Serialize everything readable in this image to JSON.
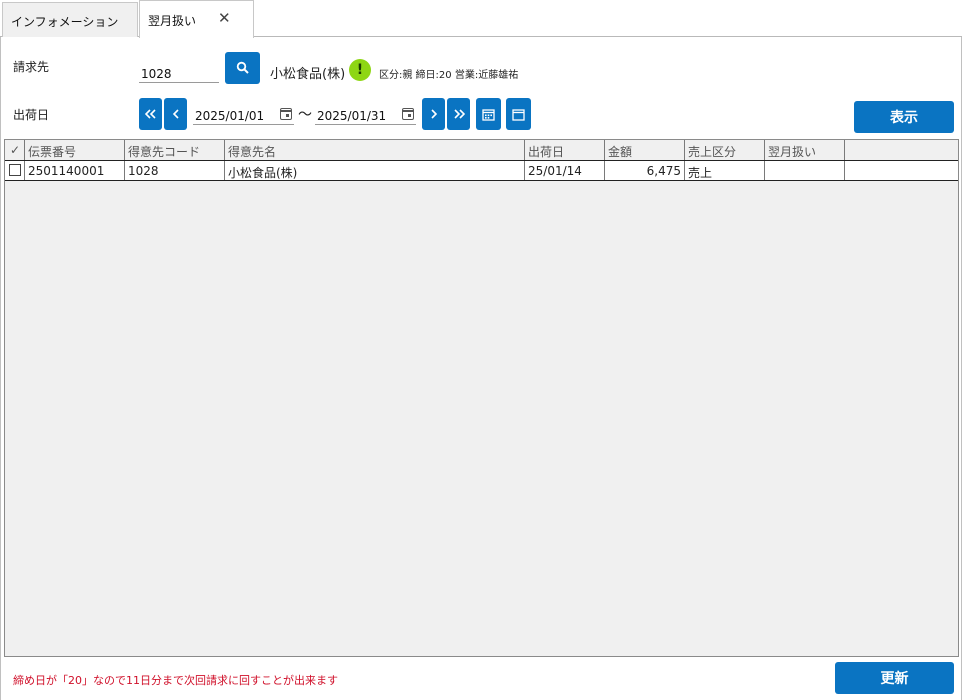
{
  "tabs": [
    {
      "label": "インフォメーション"
    },
    {
      "label": "翌月扱い"
    }
  ],
  "form": {
    "billing_label": "請求先",
    "billing_code": "1028",
    "customer_name": "小松食品(株)",
    "warning_glyph": "!",
    "customer_info": "区分:親 締日:20 営業:近藤雄祐",
    "ship_date_label": "出荷日",
    "date_from": "2025/01/01",
    "date_to": "2025/01/31",
    "range_separator": "～",
    "show_button": "表示"
  },
  "grid": {
    "columns": [
      "✓",
      "伝票番号",
      "得意先コード",
      "得意先名",
      "出荷日",
      "金額",
      "売上区分",
      "翌月扱い"
    ],
    "rows": [
      {
        "checked": false,
        "slip_no": "2501140001",
        "customer_code": "1028",
        "customer_name": "小松食品(株)",
        "ship_date": "25/01/14",
        "amount": "6,475",
        "sales_type": "売上",
        "next_month": ""
      }
    ]
  },
  "footer": {
    "note": "締め日が「20」なので11日分まで次回請求に回すことが出来ます",
    "update_button": "更新"
  },
  "colors": {
    "accent": "#0a74c2",
    "warning": "#8ed614",
    "note": "#d0102a"
  }
}
